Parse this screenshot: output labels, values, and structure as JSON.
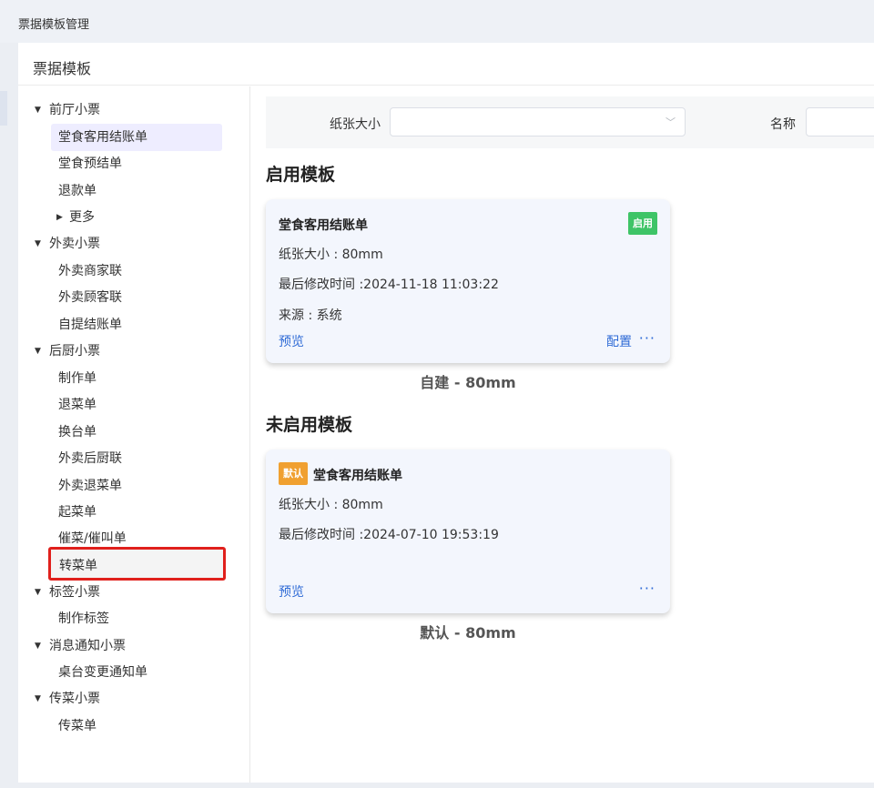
{
  "app": {
    "breadcrumb": "票据模板管理"
  },
  "panel": {
    "title": "票据模板"
  },
  "tree": {
    "groups": [
      {
        "label": "前厅小票",
        "items": [
          "堂食客用结账单",
          "堂食预结单",
          "退款单"
        ],
        "more": "更多"
      },
      {
        "label": "外卖小票",
        "items": [
          "外卖商家联",
          "外卖顾客联",
          "自提结账单"
        ]
      },
      {
        "label": "后厨小票",
        "items": [
          "制作单",
          "退菜单",
          "换台单",
          "外卖后厨联",
          "外卖退菜单",
          "起菜单",
          "催菜/催叫单",
          "转菜单"
        ]
      },
      {
        "label": "标签小票",
        "items": [
          "制作标签"
        ]
      },
      {
        "label": "消息通知小票",
        "items": [
          "桌台变更通知单"
        ]
      },
      {
        "label": "传菜小票",
        "items": [
          "传菜单"
        ]
      }
    ],
    "selected": "堂食客用结账单",
    "highlighted": "转菜单"
  },
  "filter": {
    "paper_size_label": "纸张大小",
    "paper_size_value": "",
    "name_label": "名称",
    "name_value": ""
  },
  "enabled_section": {
    "title": "启用模板",
    "card": {
      "title": "堂食客用结账单",
      "badge": "启用",
      "paper_size": "纸张大小 : 80mm",
      "modified": "最后修改时间 :2024-11-18 11:03:22",
      "source": "来源 : 系统",
      "preview": "预览",
      "config": "配置",
      "more": "···"
    },
    "caption": "自建 - 80mm"
  },
  "disabled_section": {
    "title": "未启用模板",
    "card": {
      "badge": "默认",
      "title": "堂食客用结账单",
      "paper_size": "纸张大小 : 80mm",
      "modified": "最后修改时间 :2024-07-10 19:53:19",
      "preview": "预览",
      "more": "···"
    },
    "caption": "默认 - 80mm"
  },
  "colors": {
    "accent_link": "#2f6bd6",
    "enabled_badge": "#3ec467",
    "default_badge": "#f0a030",
    "highlight_border": "#e0201c",
    "selected_bg": "#eeedff"
  },
  "icons": {
    "tree_expand": "caret-down-icon",
    "tree_collapse": "caret-right-icon",
    "select": "chevron-down-icon",
    "card_menu": "more-dots-icon"
  }
}
